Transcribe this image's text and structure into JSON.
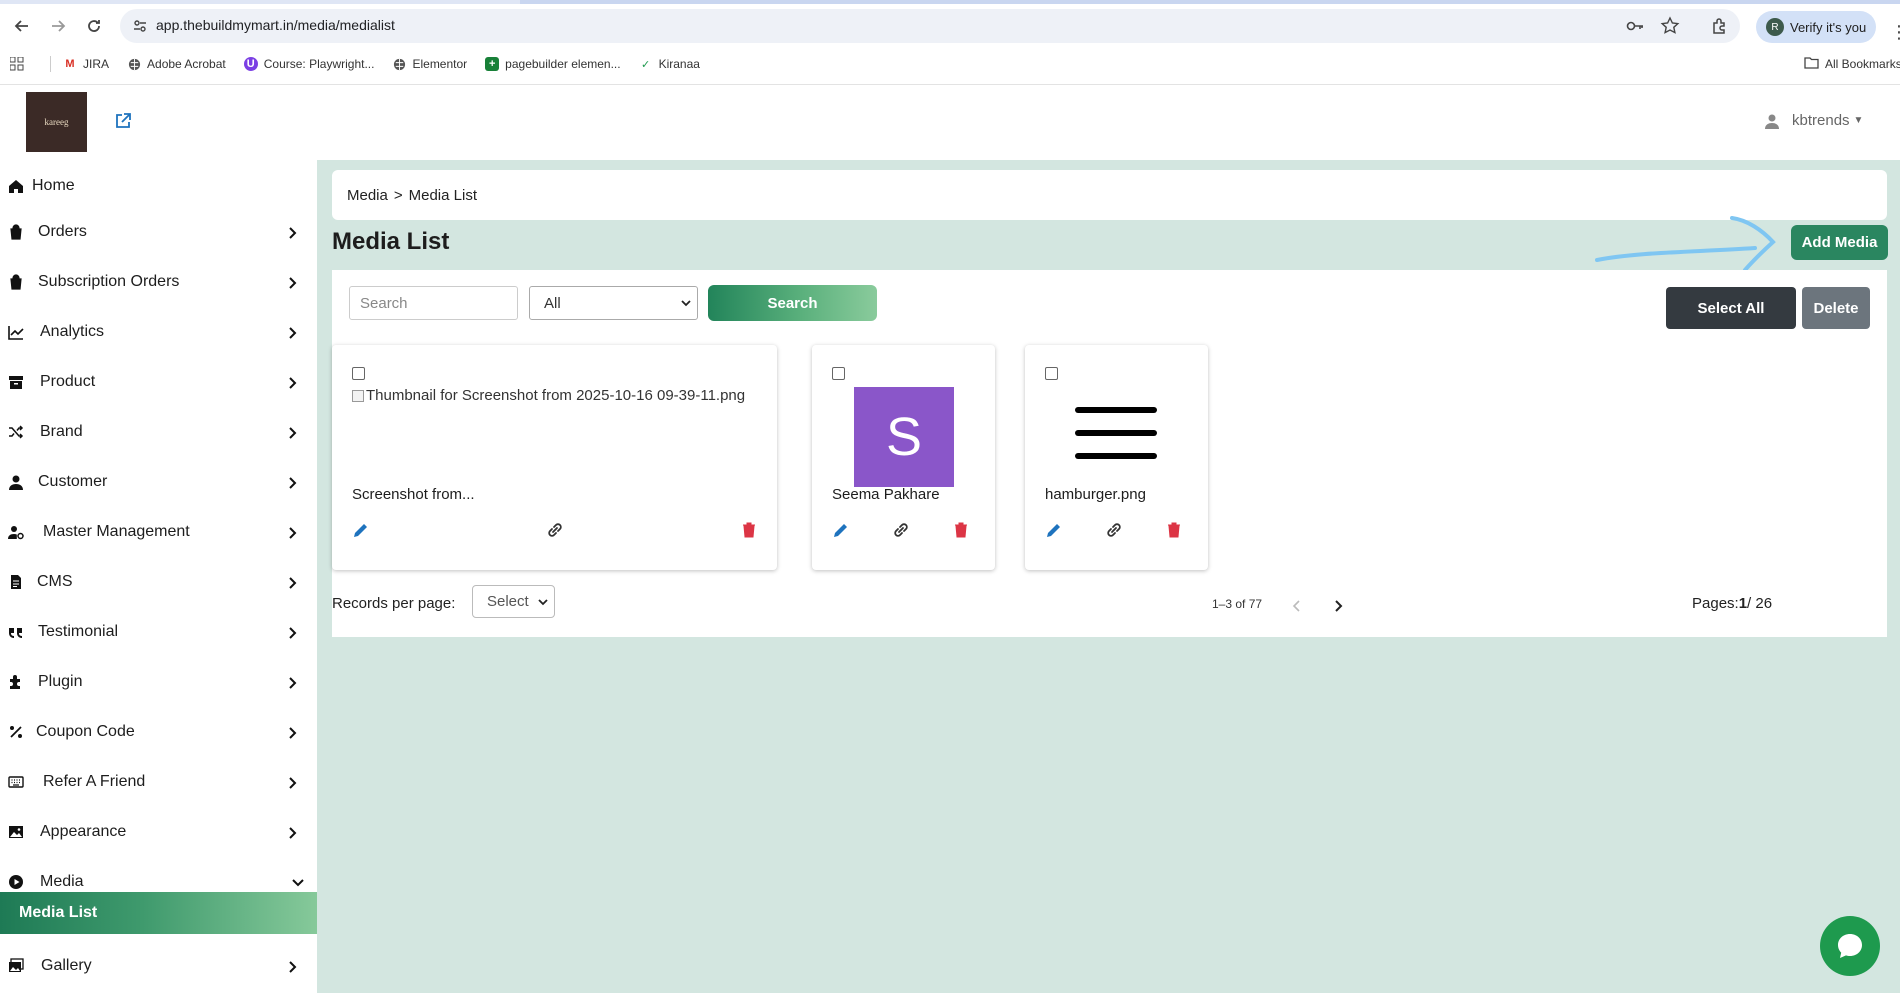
{
  "browser": {
    "url": "app.thebuildmymart.in/media/medialist",
    "verify_label": "Verify it's you",
    "verify_avatar": "R",
    "bookmarks": [
      {
        "label": "JIRA",
        "icon": "gmail-icon"
      },
      {
        "label": "Adobe Acrobat",
        "icon": "globe-icon"
      },
      {
        "label": "Course: Playwright...",
        "icon": "udemy-icon"
      },
      {
        "label": "Elementor",
        "icon": "globe-icon"
      },
      {
        "label": "pagebuilder elemen...",
        "icon": "sheets-icon"
      },
      {
        "label": "Kiranaa",
        "icon": "check-icon"
      }
    ],
    "all_bookmarks_label": "All Bookmarks"
  },
  "header": {
    "logo_text": "kareeg",
    "user_name": "kbtrends"
  },
  "sidebar": {
    "items": [
      {
        "label": "Home",
        "icon": "home-icon",
        "expandable": false
      },
      {
        "label": "Orders",
        "icon": "bag-icon",
        "expandable": true
      },
      {
        "label": "Subscription Orders",
        "icon": "bag-icon",
        "expandable": true
      },
      {
        "label": "Analytics",
        "icon": "chart-line-icon",
        "expandable": true
      },
      {
        "label": "Product",
        "icon": "box-icon",
        "expandable": true
      },
      {
        "label": "Brand",
        "icon": "shuffle-icon",
        "expandable": true
      },
      {
        "label": "Customer",
        "icon": "user-icon",
        "expandable": true
      },
      {
        "label": "Master Management",
        "icon": "user-gear-icon",
        "expandable": true
      },
      {
        "label": "CMS",
        "icon": "file-icon",
        "expandable": true
      },
      {
        "label": "Testimonial",
        "icon": "quote-icon",
        "expandable": true
      },
      {
        "label": "Plugin",
        "icon": "puzzle-icon",
        "expandable": true
      },
      {
        "label": "Coupon Code",
        "icon": "percent-icon",
        "expandable": true
      },
      {
        "label": "Refer A Friend",
        "icon": "keyboard-icon",
        "expandable": true
      },
      {
        "label": "Appearance",
        "icon": "image-icon",
        "expandable": true
      },
      {
        "label": "Media",
        "icon": "play-circle-icon",
        "expandable": true,
        "expanded": true
      },
      {
        "label": "Gallery",
        "icon": "images-icon",
        "expandable": true
      }
    ],
    "active_subitem": "Media List"
  },
  "main": {
    "breadcrumb": {
      "parent": "Media",
      "separator": ">",
      "current": "Media List"
    },
    "title": "Media List",
    "add_media_label": "Add Media",
    "search": {
      "placeholder": "Search",
      "type_selected": "All",
      "button_label": "Search"
    },
    "select_all_label": "Select All",
    "delete_label": "Delete",
    "media": [
      {
        "name": "Screenshot from...",
        "thumbnail_alt": "Thumbnail for Screenshot from 2025-10-16 09-39-11.png",
        "kind": "broken-image"
      },
      {
        "name": "Seema Pakhare",
        "avatar_letter": "S",
        "kind": "avatar"
      },
      {
        "name": "hamburger.png",
        "kind": "hamburger"
      }
    ],
    "pagination": {
      "records_label": "Records per page:",
      "records_selected": "Select",
      "range": "1–3 of 77",
      "pages_prefix": "Pages:",
      "current_page": "1",
      "total_pages": "/ 26"
    }
  },
  "colors": {
    "primary_green": "#2a8660",
    "main_bg": "#d3e6e0",
    "avatar_purple": "#8a56c9",
    "delete_red": "#dc3545",
    "edit_blue": "#1e73be"
  }
}
